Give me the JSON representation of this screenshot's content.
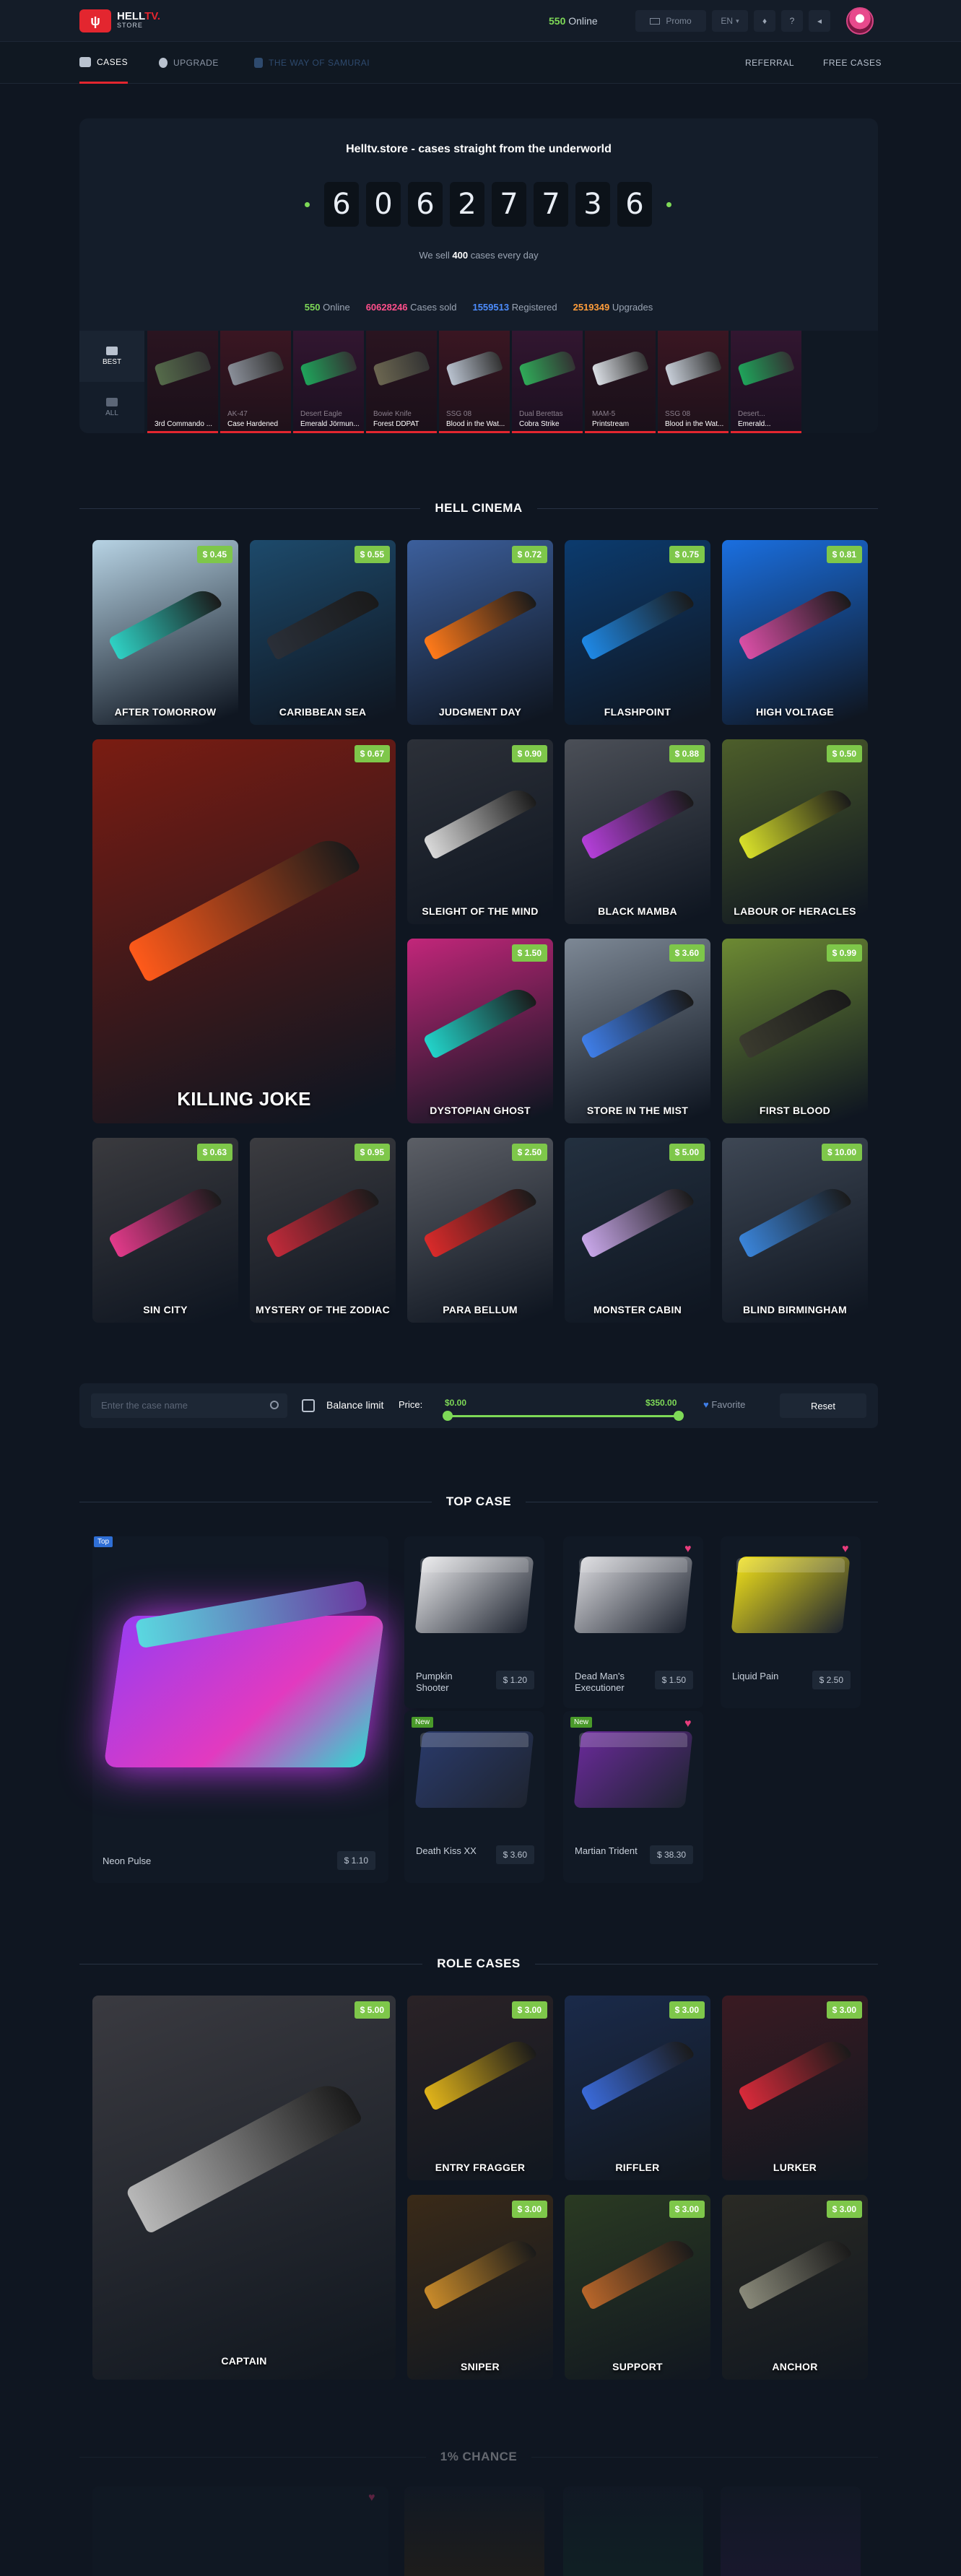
{
  "header": {
    "logo_main": "HELL",
    "logo_accent": "TV.",
    "logo_sub": "STORE",
    "online_count": "550",
    "online_label": "Online",
    "promo": "Promo",
    "lang": "EN"
  },
  "nav": {
    "cases": "CASES",
    "upgrade": "UPGRADE",
    "samurai": "THE WAY OF SAMURAI",
    "referral": "REFERRAL",
    "free_cases": "FREE CASES"
  },
  "hero": {
    "title": "Helltv.store - cases straight from the underworld",
    "digits": [
      "6",
      "0",
      "6",
      "2",
      "7",
      "7",
      "3",
      "6"
    ],
    "sub_pre": "We sell",
    "sub_num": "400",
    "sub_post": "cases every day",
    "stats": [
      {
        "value": "550",
        "label": "Online",
        "color": "#7ed957"
      },
      {
        "value": "60628246",
        "label": "Cases sold",
        "color": "#ff4f8b"
      },
      {
        "value": "1559513",
        "label": "Registered",
        "color": "#4d8dff"
      },
      {
        "value": "2519349",
        "label": "Upgrades",
        "color": "#ff9d3b"
      }
    ],
    "tabs": [
      "BEST",
      "ALL"
    ]
  },
  "drops": [
    {
      "weapon": "",
      "skin": "3rd Commando ...",
      "color": "#556b4a"
    },
    {
      "weapon": "AK-47",
      "skin": "Case Hardened",
      "color": "#8a8f99"
    },
    {
      "weapon": "Desert Eagle",
      "skin": "Emerald Jörmun...",
      "color": "#1fa35a"
    },
    {
      "weapon": "Bowie Knife",
      "skin": "Forest DDPAT",
      "color": "#6b6650"
    },
    {
      "weapon": "SSG 08",
      "skin": "Blood in the Wat...",
      "color": "#b9c2cf"
    },
    {
      "weapon": "Dual Berettas",
      "skin": "Cobra Strike",
      "color": "#2faa58"
    },
    {
      "weapon": "MAM-5",
      "skin": "Printstream",
      "color": "#d9dde3"
    },
    {
      "weapon": "SSG 08",
      "skin": "Blood in the Wat...",
      "color": "#c7ced8"
    },
    {
      "weapon": "Desert...",
      "skin": "Emerald...",
      "color": "#1fa35a"
    }
  ],
  "cinema": {
    "title": "HELL CINEMA",
    "cards": [
      {
        "name": "AFTER TOMORROW",
        "price": "$ 0.45",
        "bg": "#b7d3e4",
        "art": "#2fd1c4"
      },
      {
        "name": "CARIBBEAN SEA",
        "price": "$ 0.55",
        "bg": "#1d4a6b",
        "art": "#2a2f38"
      },
      {
        "name": "JUDGMENT DAY",
        "price": "$ 0.72",
        "bg": "#3c5f9c",
        "art": "#ff7a1a"
      },
      {
        "name": "FLASHPOINT",
        "price": "$ 0.75",
        "bg": "#0c3b6e",
        "art": "#1e88e5"
      },
      {
        "name": "HIGH VOLTAGE",
        "price": "$ 0.81",
        "bg": "#1a6fe0",
        "art": "#d94fa6"
      },
      {
        "name": "KILLING JOKE",
        "price": "$ 0.67",
        "bg": "#7a1c12",
        "art": "#ff5a1a"
      },
      {
        "name": "SLEIGHT OF THE MIND",
        "price": "$ 0.90",
        "bg": "#2c3038",
        "art": "#d9d9d9"
      },
      {
        "name": "BLACK MAMBA",
        "price": "$ 0.88",
        "bg": "#4b4f57",
        "art": "#b43fd9"
      },
      {
        "name": "LABOUR OF HERACLES",
        "price": "$ 0.50",
        "bg": "#4d5e2a",
        "art": "#d8e02a"
      },
      {
        "name": "DYSTOPIAN GHOST",
        "price": "$ 1.50",
        "bg": "#c2267a",
        "art": "#22d3c9"
      },
      {
        "name": "STORE IN THE MIST",
        "price": "$ 3.60",
        "bg": "#7d8895",
        "art": "#3f7ee8"
      },
      {
        "name": "FIRST BLOOD",
        "price": "$ 0.99",
        "bg": "#6d8a33",
        "art": "#3a3a2e"
      },
      {
        "name": "SIN CITY",
        "price": "$ 0.63",
        "bg": "#3a3a3e",
        "art": "#e23a8a"
      },
      {
        "name": "MYSTERY OF THE ZODIAC",
        "price": "$ 0.95",
        "bg": "#3c3c40",
        "art": "#c22a3a"
      },
      {
        "name": "PARA BELLUM",
        "price": "$ 2.50",
        "bg": "#5c5f66",
        "art": "#d92a2a"
      },
      {
        "name": "MONSTER CABIN",
        "price": "$ 5.00",
        "bg": "#23303f",
        "art": "#c7a6e8"
      },
      {
        "name": "BLIND BIRMINGHAM",
        "price": "$ 10.00",
        "bg": "#3e4754",
        "art": "#3a84d9"
      }
    ]
  },
  "filter": {
    "search_placeholder": "Enter the case name",
    "balance_limit": "Balance limit",
    "price_label": "Price:",
    "min": "$0.00",
    "max": "$350.00",
    "range": [
      0,
      1
    ],
    "favorite": "Favorite",
    "reset": "Reset"
  },
  "top_case": {
    "title": "TOP CASE",
    "big": {
      "tag": "Top",
      "name": "Neon Pulse",
      "price": "$ 1.10"
    },
    "cases": [
      {
        "name": "Pumpkin Shooter",
        "price": "$ 1.20",
        "tag": "",
        "heart": false,
        "color": "#e8e8ea"
      },
      {
        "name": "Dead Man's Executioner",
        "price": "$ 1.50",
        "tag": "",
        "heart": true,
        "color": "#d8d8dc"
      },
      {
        "name": "Liquid Pain",
        "price": "$ 2.50",
        "tag": "",
        "heart": true,
        "color": "#f0e01a"
      },
      {
        "name": "Death Kiss XX",
        "price": "$ 3.60",
        "tag": "New",
        "heart": false,
        "color": "#2a3a6a"
      },
      {
        "name": "Martian Trident",
        "price": "$ 38.30",
        "tag": "New",
        "heart": true,
        "color": "#6a2a9a"
      }
    ]
  },
  "role_cases": {
    "title": "ROLE CASES",
    "cards": [
      {
        "name": "CAPTAIN",
        "price": "$ 5.00",
        "bg": "#3a3a40",
        "art": "#b8b8b8"
      },
      {
        "name": "ENTRY FRAGGER",
        "price": "$ 3.00",
        "bg": "#2a2226",
        "art": "#e0b31a"
      },
      {
        "name": "RIFFLER",
        "price": "$ 3.00",
        "bg": "#1a2a4a",
        "art": "#3a6ad9"
      },
      {
        "name": "LURKER",
        "price": "$ 3.00",
        "bg": "#3a1a22",
        "art": "#d92a3a"
      },
      {
        "name": "SNIPER",
        "price": "$ 3.00",
        "bg": "#3a2a18",
        "art": "#c88a2a"
      },
      {
        "name": "SUPPORT",
        "price": "$ 3.00",
        "bg": "#2a3a22",
        "art": "#b8662a"
      },
      {
        "name": "ANCHOR",
        "price": "$ 3.00",
        "bg": "#2a2a24",
        "art": "#8a8a7a"
      }
    ]
  },
  "chance": {
    "title": "1% CHANCE"
  }
}
